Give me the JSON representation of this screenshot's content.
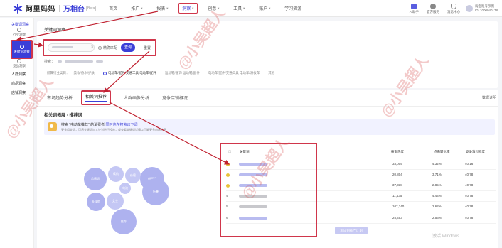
{
  "topnav": {
    "brand": "阿里妈妈",
    "product": "万相台",
    "badge": "Beta",
    "menu": [
      {
        "label": "首页",
        "caret": false
      },
      {
        "label": "推广",
        "caret": true
      },
      {
        "label": "报表",
        "caret": true
      },
      {
        "label": "洞察",
        "caret": true,
        "active": true
      },
      {
        "label": "创意",
        "caret": true
      },
      {
        "label": "工具",
        "caret": true
      },
      {
        "label": "账户",
        "caret": true
      },
      {
        "label": "学习资源",
        "caret": false
      }
    ],
    "right_icons": [
      {
        "name": "ai-assistant-icon",
        "label": "AI助手"
      },
      {
        "name": "service-icon",
        "label": "官方服务"
      },
      {
        "name": "message-icon",
        "label": "消息中心"
      }
    ],
    "user_line1": "淘宝账号示例",
    "user_line2": "ID: 1000040178"
  },
  "sidebar": {
    "heading": "关键词洞察",
    "items": [
      {
        "label": "行业洞察"
      },
      {
        "label": "关键词洞察",
        "selected": true
      },
      {
        "label": "竞品洞察"
      }
    ],
    "groups": [
      "人群洞察",
      "商品洞察",
      "店铺洞察"
    ]
  },
  "search": {
    "title": "关键词洞察",
    "placeholder": "请输入关键词",
    "clear": "×",
    "exact_label": "精确匹配",
    "search_btn": "查询",
    "reset_btn": "重置",
    "history_label": "搜索：",
    "industry_label": "所属行业类目：",
    "industry_options": [
      {
        "label": "美妆/香水/护肤",
        "selected": false
      },
      {
        "label": "电动车/配件/交通工具 电动车/配件",
        "selected": true
      },
      {
        "label": "运动鞋/服饰 运动鞋/配件",
        "selected": false
      },
      {
        "label": "电动车/配件/交通工具 电动车/滑板车",
        "selected": false
      },
      {
        "label": "其他",
        "selected": false
      }
    ]
  },
  "tabs": {
    "items": [
      {
        "label": "市场趋势分析",
        "active": false
      },
      {
        "label": "相关词推荐",
        "active": true
      },
      {
        "label": "人群画像分析",
        "active": false
      },
      {
        "label": "竞争店铺概况",
        "active": false
      }
    ],
    "right": "数据说明"
  },
  "content": {
    "section_title": "相关词拓展 · 推荐词",
    "banner_title_a": "搜索 “电动车推荐” 的消费者",
    "banner_title_b": "同时也在搜索以下词",
    "banner_sub": "更多相关词，可将关键词加入计划进行投放，或查看关键词详情以了解更多市场信息",
    "bubbles": [
      "品牌词",
      "续航",
      "价格",
      "新国标",
      "电池",
      "长续航",
      "女士",
      "折叠",
      "推荐"
    ],
    "table_header": {
      "keyword": "关键词",
      "c1": "搜索热度",
      "c2": "点击转化率",
      "c3": "竞争激烈程度"
    },
    "rows": [
      {
        "marker": "dot",
        "c1": "33,005",
        "c2": "4.32%",
        "c3": "40.16"
      },
      {
        "marker": "dot",
        "c1": "20,804",
        "c2": "3.71%",
        "c3": "40.78"
      },
      {
        "marker": "dot",
        "c1": "37,338",
        "c2": "2.85%",
        "c3": "40.78"
      },
      {
        "marker": "4",
        "c1": "11,435",
        "c2": "4.44%",
        "c3": "40.78"
      },
      {
        "marker": "5",
        "c1": "107,340",
        "c2": "2.62%",
        "c3": "40.78"
      },
      {
        "marker": "6",
        "c1": "25,453",
        "c2": "2.56%",
        "c3": "40.78"
      }
    ],
    "more_button": "添加到推广计划"
  },
  "watermark_text": "@小吴超人",
  "os_watermark": "激活 Windows",
  "colors": {
    "accent": "#3b3fd8",
    "annotation": "#d0364b",
    "bubble": "#aeb2ef"
  }
}
